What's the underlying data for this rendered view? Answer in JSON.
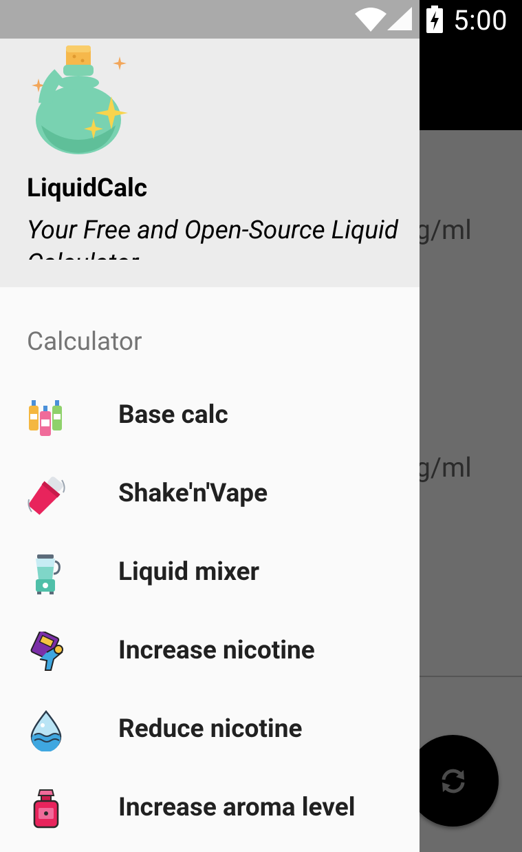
{
  "status_bar": {
    "time": "5:00"
  },
  "background": {
    "unit_1": "g/ml",
    "unit_2": "g/ml"
  },
  "drawer": {
    "app_title": "LiquidCalc",
    "subtitle": "Your Free and Open-Source Liquid Calculator",
    "section_title": "Calculator",
    "items": [
      {
        "label": "Base calc",
        "icon": "bottles-icon"
      },
      {
        "label": "Shake'n'Vape",
        "icon": "shaker-icon"
      },
      {
        "label": "Liquid mixer",
        "icon": "blender-icon"
      },
      {
        "label": "Increase nicotine",
        "icon": "strong-hand-icon"
      },
      {
        "label": "Reduce nicotine",
        "icon": "water-drop-icon"
      },
      {
        "label": "Increase aroma level",
        "icon": "perfume-bottle-icon"
      }
    ]
  },
  "colors": {
    "drawer_header": "#ececec",
    "drawer_body": "#fafafa",
    "scrim": "#6b6b6b",
    "toolbar": "#000000"
  }
}
